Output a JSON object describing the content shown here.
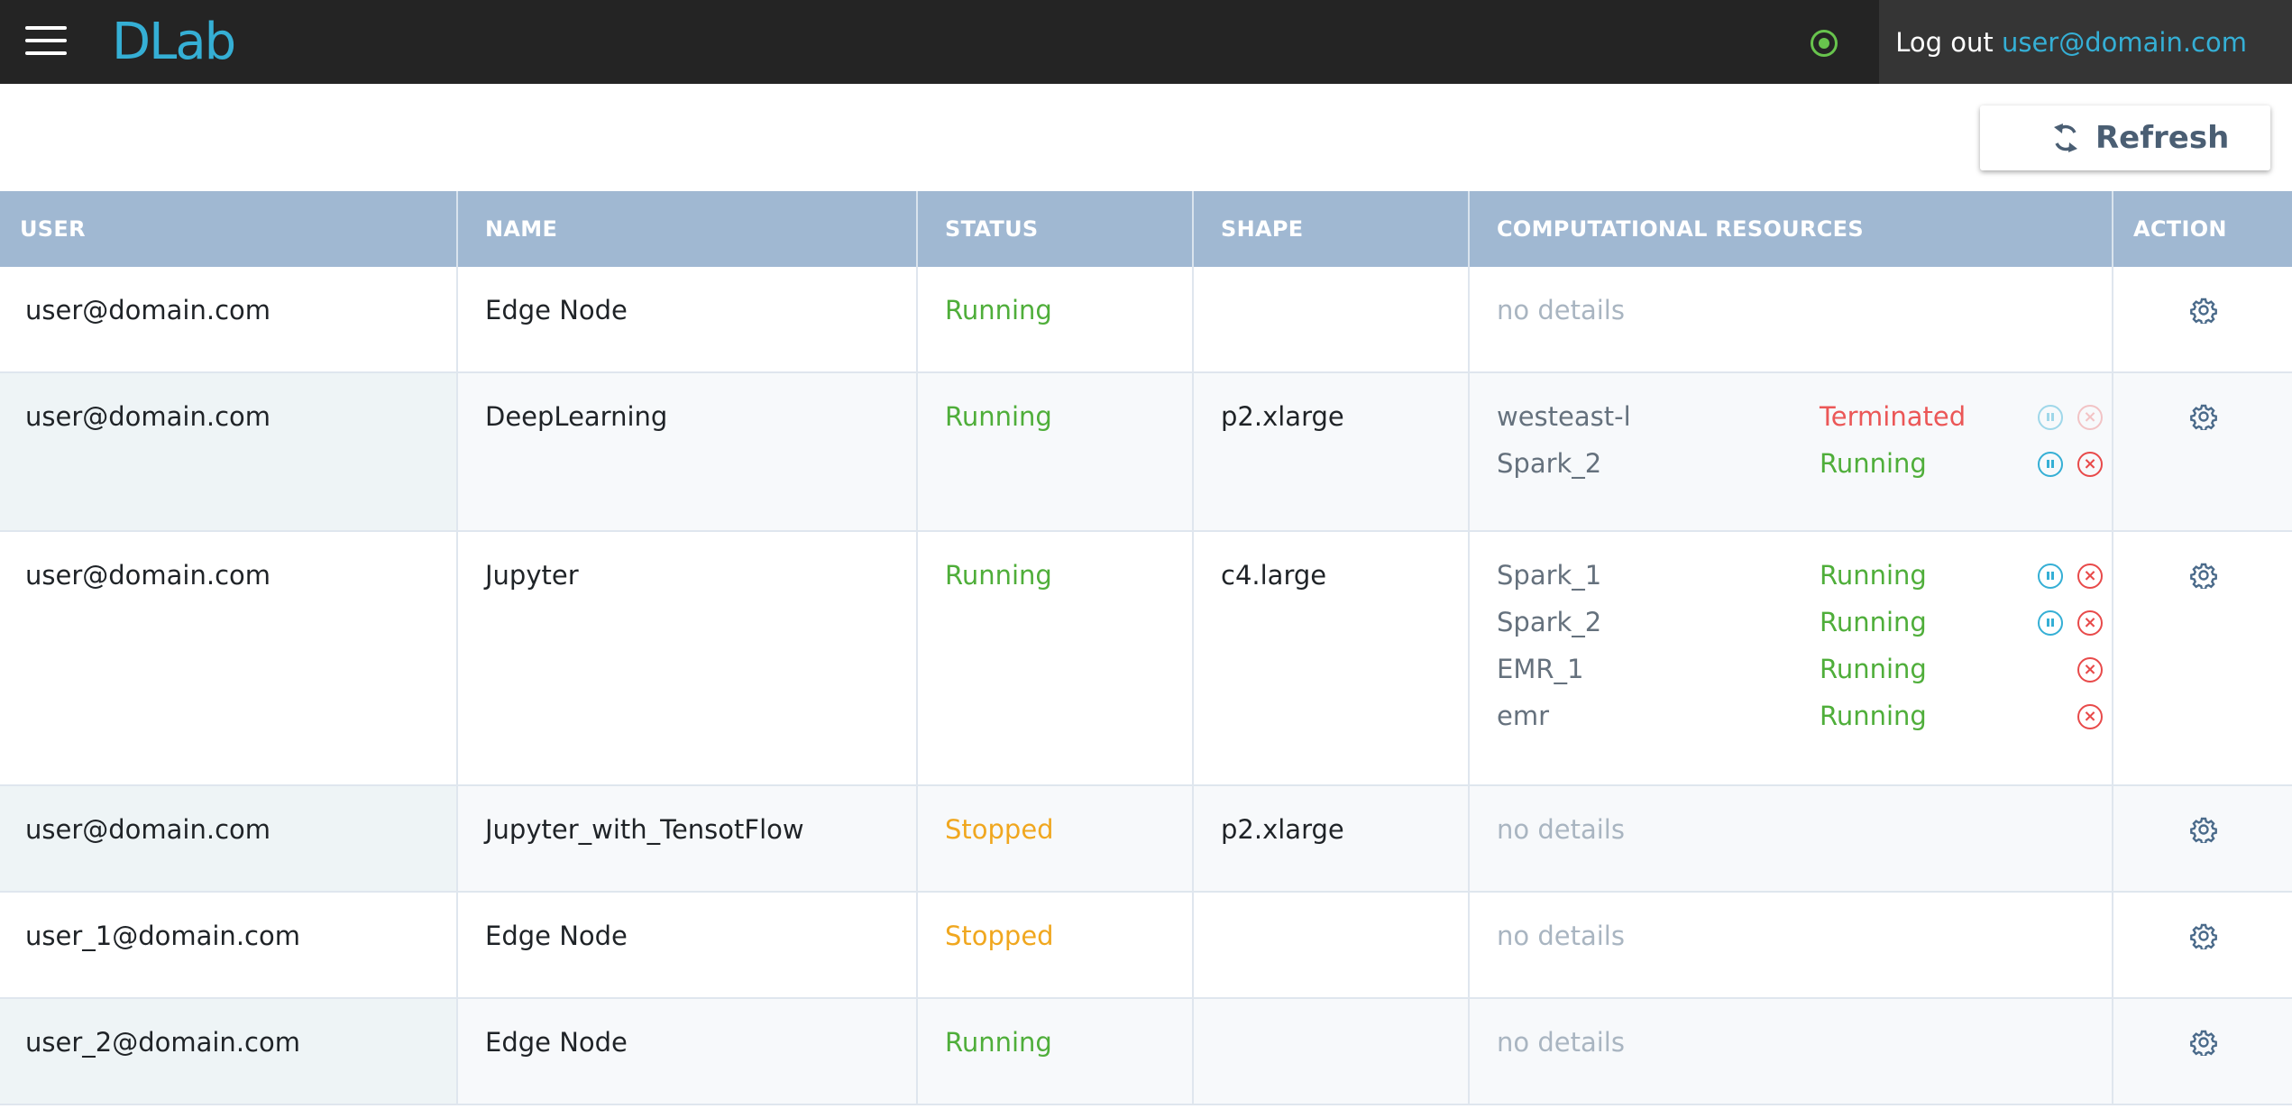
{
  "header": {
    "app_name": "DLab",
    "logout_label": "Log out",
    "current_user": "user@domain.com",
    "accent_color": "#35afd5",
    "status_color": "#68c44d"
  },
  "toolbar": {
    "refresh_label": "Refresh",
    "refresh_icon": "refresh-icon"
  },
  "table": {
    "columns": [
      "USER",
      "NAME",
      "STATUS",
      "SHAPE",
      "COMPUTATIONAL RESOURCES",
      "ACTION"
    ],
    "no_details_label": "no details",
    "rows": [
      {
        "user": "user@domain.com",
        "name": "Edge Node",
        "status": "Running",
        "shape": "",
        "resources": []
      },
      {
        "user": "user@domain.com",
        "name": "DeepLearning",
        "status": "Running",
        "shape": "p2.xlarge",
        "resources": [
          {
            "name": "westeast-l",
            "status": "Terminated"
          },
          {
            "name": "Spark_2",
            "status": "Running"
          }
        ]
      },
      {
        "user": "user@domain.com",
        "name": "Jupyter",
        "status": "Running",
        "shape": "c4.large",
        "resources": [
          {
            "name": "Spark_1",
            "status": "Running"
          },
          {
            "name": "Spark_2",
            "status": "Running"
          },
          {
            "name": "EMR_1",
            "status": "Running"
          },
          {
            "name": "emr",
            "status": "Running"
          }
        ]
      },
      {
        "user": "user@domain.com",
        "name": "Jupyter_with_TensotFlow",
        "status": "Stopped",
        "shape": "p2.xlarge",
        "resources": []
      },
      {
        "user": "user_1@domain.com",
        "name": "Edge Node",
        "status": "Stopped",
        "shape": "",
        "resources": []
      },
      {
        "user": "user_2@domain.com",
        "name": "Edge Node",
        "status": "Running",
        "shape": "",
        "resources": []
      }
    ]
  },
  "status_colors": {
    "Running": "#4fae3a",
    "Stopped": "#f0a71f",
    "Terminated": "#eb5757"
  }
}
